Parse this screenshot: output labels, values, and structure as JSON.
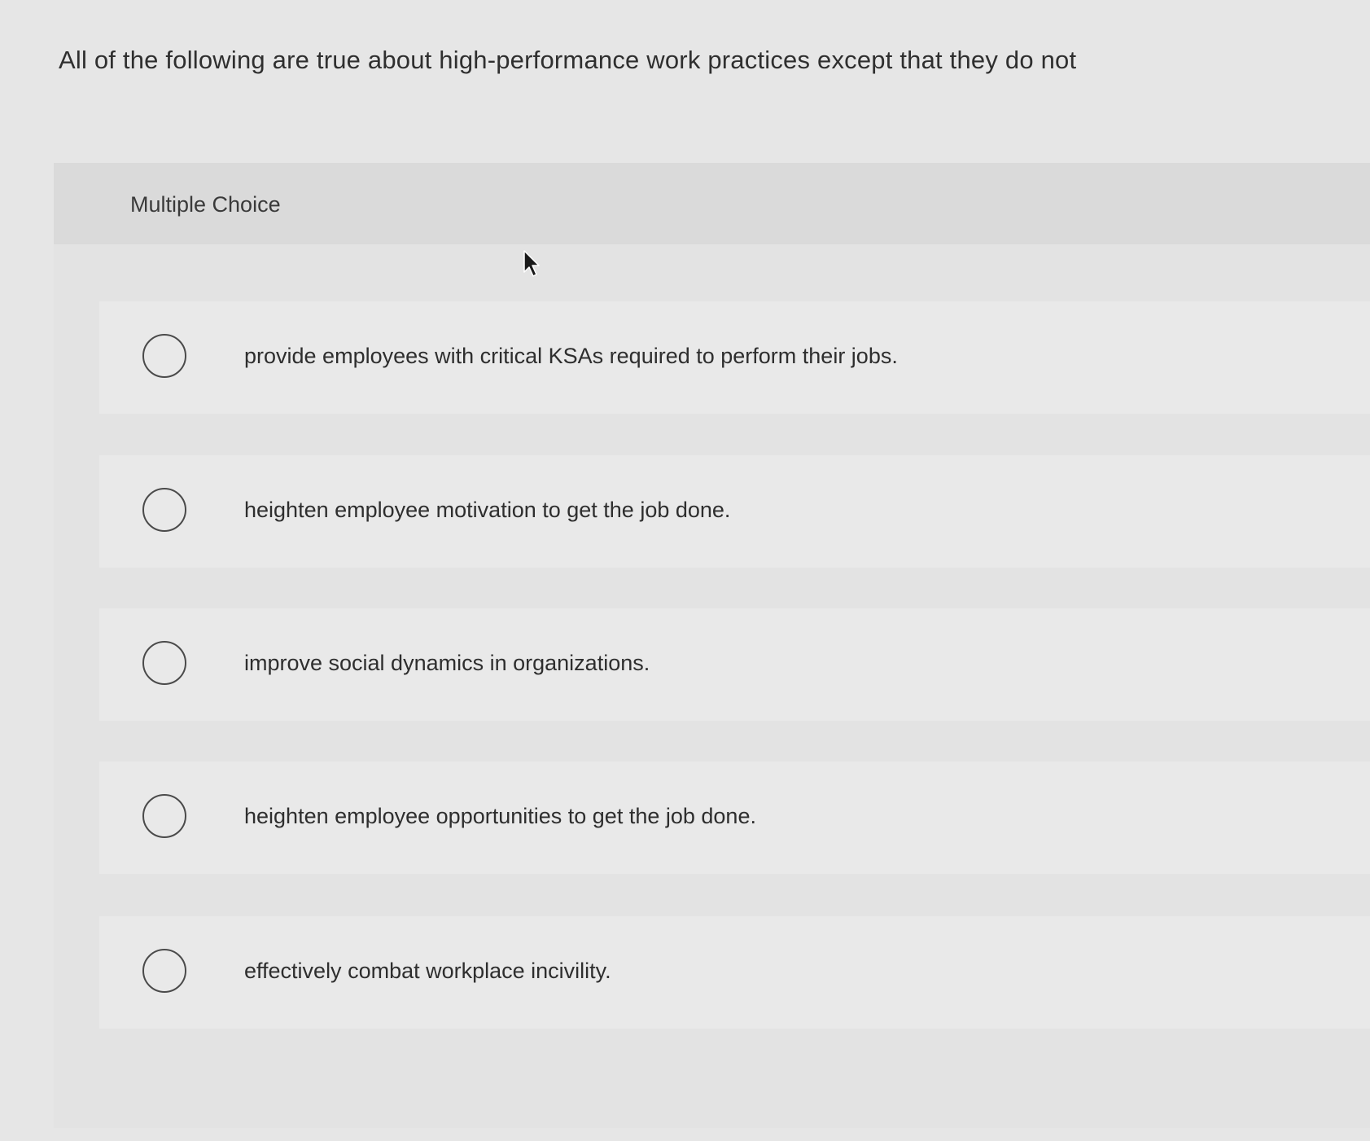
{
  "question": {
    "stem": "All of the following are true about high-performance work practices except that they do not",
    "type_label": "Multiple Choice"
  },
  "choices": [
    {
      "text": "provide employees with critical KSAs required to perform their jobs."
    },
    {
      "text": "heighten employee motivation to get the job done."
    },
    {
      "text": "improve social dynamics in organizations."
    },
    {
      "text": "heighten employee opportunities to get the job done."
    },
    {
      "text": "effectively combat workplace incivility."
    }
  ],
  "icons": {
    "radio": "radio-button-unselected-icon",
    "cursor": "mouse-pointer-icon"
  }
}
